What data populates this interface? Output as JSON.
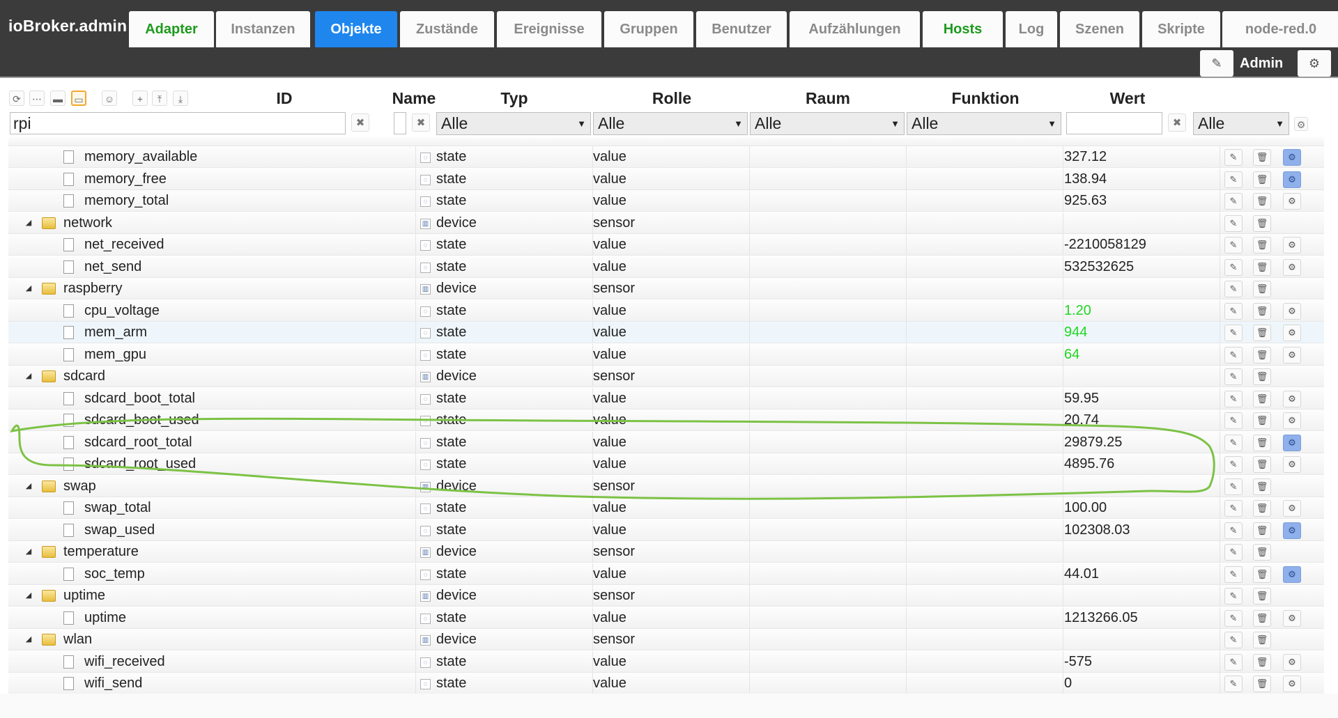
{
  "app_title": "ioBroker.admin",
  "tabs": [
    {
      "label": "Adapter",
      "state": "green"
    },
    {
      "label": "Instanzen",
      "state": ""
    },
    {
      "label": "Objekte",
      "state": "active"
    },
    {
      "label": "Zustände",
      "state": ""
    },
    {
      "label": "Ereignisse",
      "state": ""
    },
    {
      "label": "Gruppen",
      "state": ""
    },
    {
      "label": "Benutzer",
      "state": ""
    },
    {
      "label": "Aufzählungen",
      "state": ""
    },
    {
      "label": "Hosts",
      "state": "green"
    },
    {
      "label": "Log",
      "state": ""
    },
    {
      "label": "Szenen",
      "state": ""
    },
    {
      "label": "Skripte",
      "state": ""
    },
    {
      "label": "node-red.0",
      "state": ""
    }
  ],
  "user": {
    "name": "Admin",
    "edit_icon": "pencil-icon",
    "settings_icon": "gear-icon"
  },
  "columns": {
    "id": "ID",
    "name": "Name",
    "type": "Typ",
    "role": "Rolle",
    "room": "Raum",
    "function": "Funktion",
    "value": "Wert"
  },
  "filters": {
    "id": "rpi",
    "name": "",
    "value": "",
    "type": "Alle",
    "role": "Alle",
    "room": "Alle",
    "function": "Alle",
    "value_select": "Alle"
  },
  "rows": [
    {
      "name": "memory_available",
      "kind": "state",
      "level": 2,
      "type": "state",
      "role": "value",
      "value": "327.12",
      "green": false,
      "gear": "blue"
    },
    {
      "name": "memory_free",
      "kind": "state",
      "level": 2,
      "type": "state",
      "role": "value",
      "value": "138.94",
      "green": false,
      "gear": "blue"
    },
    {
      "name": "memory_total",
      "kind": "state",
      "level": 2,
      "type": "state",
      "role": "value",
      "value": "925.63",
      "green": false,
      "gear": "grey"
    },
    {
      "name": "network",
      "kind": "folder",
      "level": 1,
      "type": "device",
      "role": "sensor",
      "value": "",
      "green": false,
      "gear": "none"
    },
    {
      "name": "net_received",
      "kind": "state",
      "level": 2,
      "type": "state",
      "role": "value",
      "value": "-2210058129",
      "green": false,
      "gear": "grey"
    },
    {
      "name": "net_send",
      "kind": "state",
      "level": 2,
      "type": "state",
      "role": "value",
      "value": "532532625",
      "green": false,
      "gear": "grey"
    },
    {
      "name": "raspberry",
      "kind": "folder",
      "level": 1,
      "type": "device",
      "role": "sensor",
      "value": "",
      "green": false,
      "gear": "none"
    },
    {
      "name": "cpu_voltage",
      "kind": "state",
      "level": 2,
      "type": "state",
      "role": "value",
      "value": "1.20",
      "green": true,
      "gear": "grey"
    },
    {
      "name": "mem_arm",
      "kind": "state",
      "level": 2,
      "type": "state",
      "role": "value",
      "value": "944",
      "green": true,
      "gear": "grey",
      "highlight": true
    },
    {
      "name": "mem_gpu",
      "kind": "state",
      "level": 2,
      "type": "state",
      "role": "value",
      "value": "64",
      "green": true,
      "gear": "grey"
    },
    {
      "name": "sdcard",
      "kind": "folder",
      "level": 1,
      "type": "device",
      "role": "sensor",
      "value": "",
      "green": false,
      "gear": "none"
    },
    {
      "name": "sdcard_boot_total",
      "kind": "state",
      "level": 2,
      "type": "state",
      "role": "value",
      "value": "59.95",
      "green": false,
      "gear": "grey"
    },
    {
      "name": "sdcard_boot_used",
      "kind": "state",
      "level": 2,
      "type": "state",
      "role": "value",
      "value": "20.74",
      "green": false,
      "gear": "grey"
    },
    {
      "name": "sdcard_root_total",
      "kind": "state",
      "level": 2,
      "type": "state",
      "role": "value",
      "value": "29879.25",
      "green": false,
      "gear": "blue"
    },
    {
      "name": "sdcard_root_used",
      "kind": "state",
      "level": 2,
      "type": "state",
      "role": "value",
      "value": "4895.76",
      "green": false,
      "gear": "grey"
    },
    {
      "name": "swap",
      "kind": "folder",
      "level": 1,
      "type": "device",
      "role": "sensor",
      "value": "",
      "green": false,
      "gear": "none"
    },
    {
      "name": "swap_total",
      "kind": "state",
      "level": 2,
      "type": "state",
      "role": "value",
      "value": "100.00",
      "green": false,
      "gear": "grey"
    },
    {
      "name": "swap_used",
      "kind": "state",
      "level": 2,
      "type": "state",
      "role": "value",
      "value": "102308.03",
      "green": false,
      "gear": "blue"
    },
    {
      "name": "temperature",
      "kind": "folder",
      "level": 1,
      "type": "device",
      "role": "sensor",
      "value": "",
      "green": false,
      "gear": "none"
    },
    {
      "name": "soc_temp",
      "kind": "state",
      "level": 2,
      "type": "state",
      "role": "value",
      "value": "44.01",
      "green": false,
      "gear": "blue"
    },
    {
      "name": "uptime",
      "kind": "folder",
      "level": 1,
      "type": "device",
      "role": "sensor",
      "value": "",
      "green": false,
      "gear": "none"
    },
    {
      "name": "uptime",
      "kind": "state",
      "level": 2,
      "type": "state",
      "role": "value",
      "value": "1213266.05",
      "green": false,
      "gear": "grey"
    },
    {
      "name": "wlan",
      "kind": "folder",
      "level": 1,
      "type": "device",
      "role": "sensor",
      "value": "",
      "green": false,
      "gear": "none"
    },
    {
      "name": "wifi_received",
      "kind": "state",
      "level": 2,
      "type": "state",
      "role": "value",
      "value": "-575",
      "green": false,
      "gear": "grey"
    },
    {
      "name": "wifi_send",
      "kind": "state",
      "level": 2,
      "type": "state",
      "role": "value",
      "value": "0",
      "green": false,
      "gear": "grey"
    }
  ],
  "colors": {
    "active_tab": "#1f86ee",
    "green_text": "#1e9a1e",
    "value_green": "#21d621",
    "annotation": "#7cc245",
    "header_bg": "#3b3b3b"
  }
}
